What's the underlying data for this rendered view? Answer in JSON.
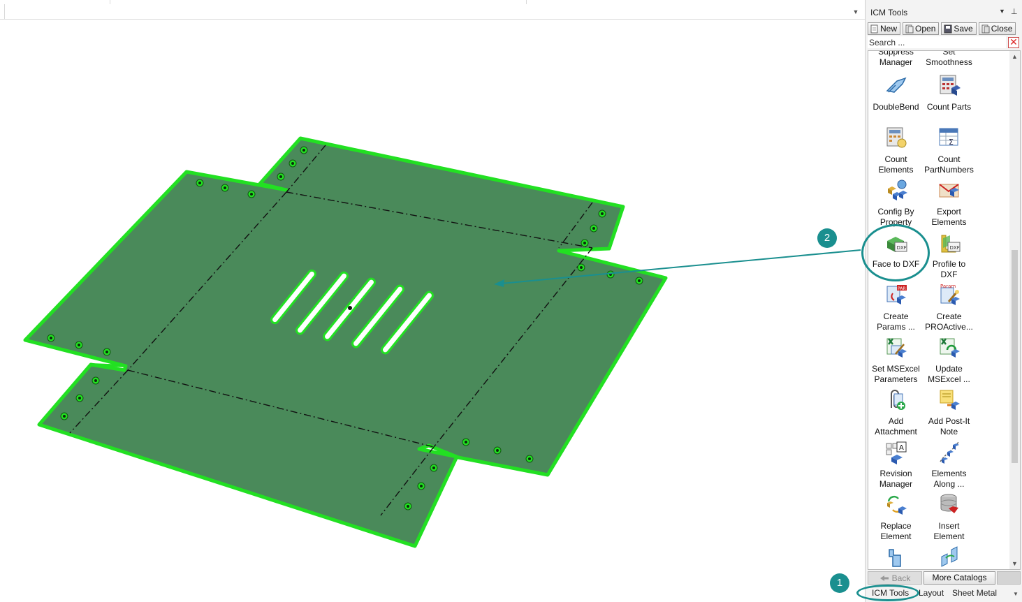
{
  "panel": {
    "title": "ICM Tools",
    "toolbar": {
      "new": "New",
      "open": "Open",
      "save": "Save",
      "close": "Close"
    },
    "search_placeholder": "Search ...",
    "items": [
      {
        "line1": "Suppress",
        "line2": "Manager",
        "icon": "suppress-manager-icon"
      },
      {
        "line1": "Set",
        "line2": "Smoothness",
        "icon": "set-smoothness-icon"
      },
      {
        "line1": "DoubleBend",
        "line2": "",
        "icon": "double-bend-icon"
      },
      {
        "line1": "Count Parts",
        "line2": "",
        "icon": "count-parts-icon"
      },
      {
        "line1": "Count",
        "line2": "Elements",
        "icon": "count-elements-icon"
      },
      {
        "line1": "Count",
        "line2": "PartNumbers",
        "icon": "count-partnumbers-icon"
      },
      {
        "line1": "Config By",
        "line2": "Property",
        "icon": "config-by-property-icon"
      },
      {
        "line1": "Export",
        "line2": "Elements",
        "icon": "export-elements-icon"
      },
      {
        "line1": "Face to DXF",
        "line2": "",
        "icon": "face-to-dxf-icon"
      },
      {
        "line1": "Profile to",
        "line2": "DXF",
        "icon": "profile-to-dxf-icon"
      },
      {
        "line1": "Create",
        "line2": "Params ...",
        "icon": "create-params-icon"
      },
      {
        "line1": "Create",
        "line2": "PROActive...",
        "icon": "create-proactive-icon"
      },
      {
        "line1": "Set MSExcel",
        "line2": "Parameters",
        "icon": "set-msexcel-parameters-icon"
      },
      {
        "line1": "Update",
        "line2": "MSExcel ...",
        "icon": "update-msexcel-icon"
      },
      {
        "line1": "Add",
        "line2": "Attachment",
        "icon": "add-attachment-icon"
      },
      {
        "line1": "Add Post-It",
        "line2": "Note",
        "icon": "add-post-it-note-icon"
      },
      {
        "line1": "Revision",
        "line2": "Manager",
        "icon": "revision-manager-icon"
      },
      {
        "line1": "Elements",
        "line2": "Along ...",
        "icon": "elements-along-icon"
      },
      {
        "line1": "Replace",
        "line2": "Element",
        "icon": "replace-element-icon"
      },
      {
        "line1": "Insert",
        "line2": "Element",
        "icon": "insert-element-icon"
      },
      {
        "line1": "",
        "line2": "",
        "icon": "hand-pointer-icon"
      },
      {
        "line1": "",
        "line2": "",
        "icon": "sheet-transform-icon"
      }
    ],
    "back": "Back",
    "more_catalogs": "More Catalogs",
    "tabs": [
      "ICM Tools",
      "Layout",
      "Sheet Metal"
    ],
    "dxf_label": "DXF",
    "par_label": "PAR",
    "param_label": "Param"
  },
  "callouts": [
    "1",
    "2"
  ],
  "colors": {
    "sheet_fill": "#4a8a5a",
    "sheet_edge": "#22e022",
    "accent": "#1a8f8f"
  }
}
